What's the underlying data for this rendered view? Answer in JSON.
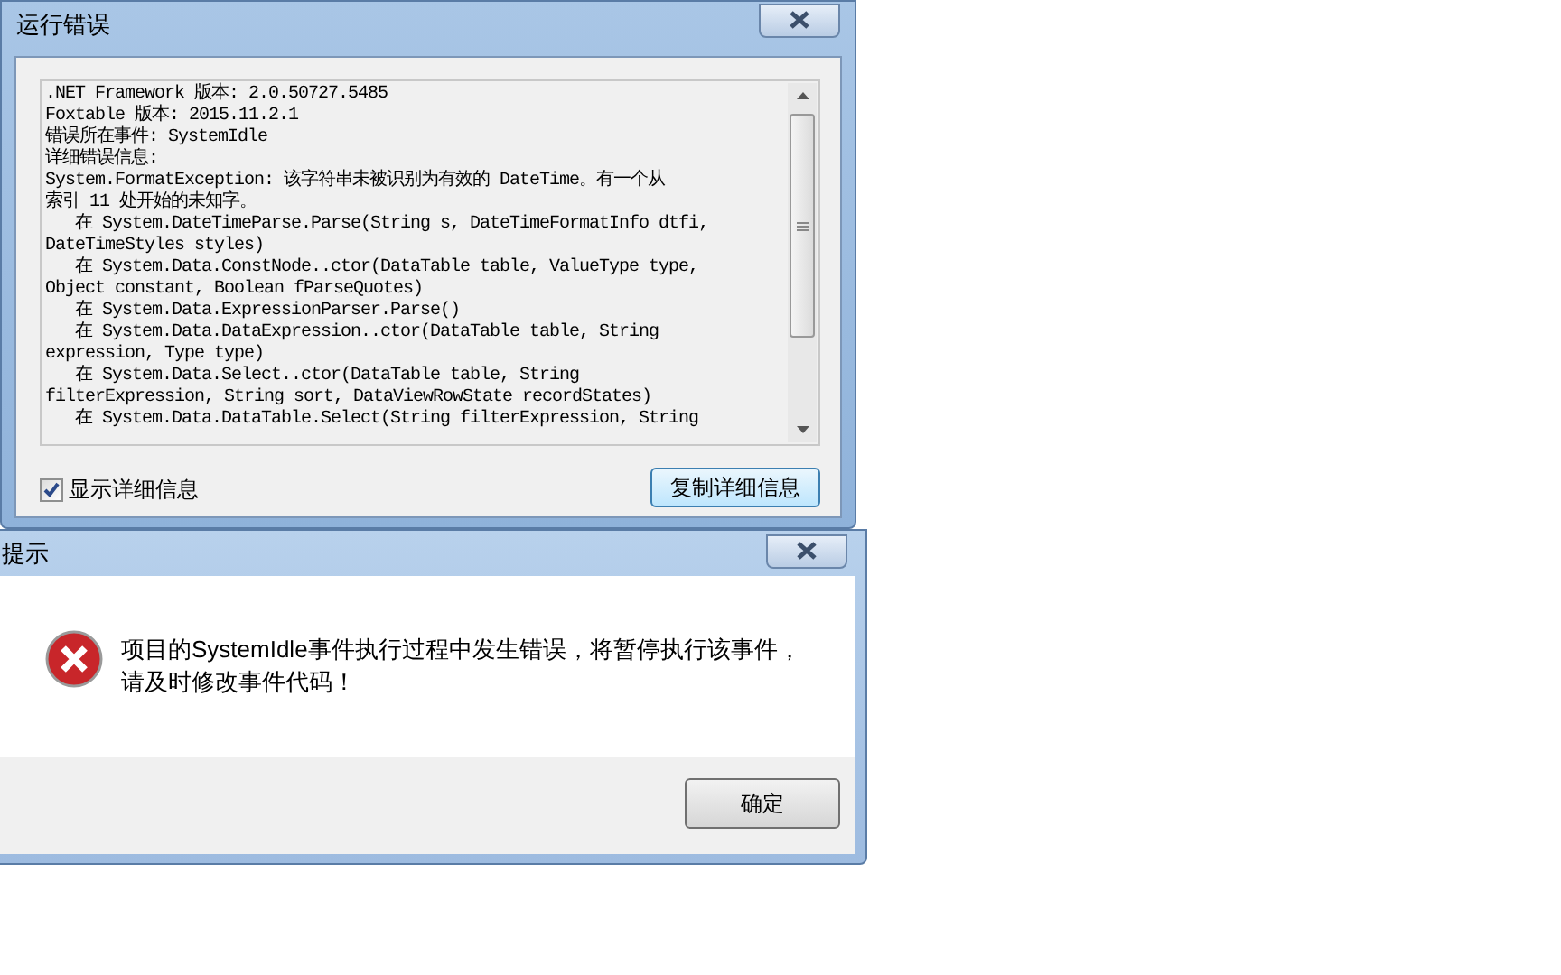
{
  "error_dialog": {
    "title": "运行错误",
    "details_lines": [
      ".NET Framework 版本: 2.0.50727.5485",
      "Foxtable 版本: 2015.11.2.1",
      "错误所在事件: SystemIdle",
      "详细错误信息:",
      "System.FormatException: 该字符串未被识别为有效的 DateTime。有一个从",
      "索引 11 处开始的未知字。",
      "   在 System.DateTimeParse.Parse(String s, DateTimeFormatInfo dtfi,",
      "DateTimeStyles styles)",
      "   在 System.Data.ConstNode..ctor(DataTable table, ValueType type,",
      "Object constant, Boolean fParseQuotes)",
      "   在 System.Data.ExpressionParser.Parse()",
      "   在 System.Data.DataExpression..ctor(DataTable table, String",
      "expression, Type type)",
      "   在 System.Data.Select..ctor(DataTable table, String",
      "filterExpression, String sort, DataViewRowState recordStates)",
      "   在 System.Data.DataTable.Select(String filterExpression, String"
    ],
    "show_details": {
      "label": "显示详细信息",
      "checked": true
    },
    "copy_button": "复制详细信息"
  },
  "prompt_dialog": {
    "title": "提示",
    "message": "项目的SystemIdle事件执行过程中发生错误，将暂停执行该事件，请及时修改事件代码！",
    "ok_button": "确定"
  }
}
